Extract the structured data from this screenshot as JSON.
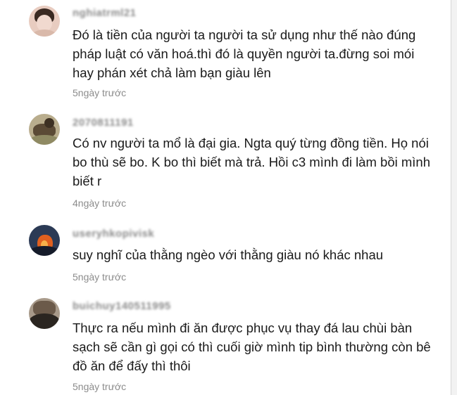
{
  "comments": [
    {
      "username": "nghiatrml21",
      "text": "Đó là tiền của người ta người ta sử dụng như thế nào đúng pháp luật có văn hoá.thì đó là quyền người ta.đừng soi mói hay phán xét chả làm bạn giàu lên",
      "time": "5ngày trước",
      "avatar_colors": [
        "#f1d9cf",
        "#3a2a22",
        "#d9b9aa"
      ]
    },
    {
      "username": "2070811191",
      "text": "Có nv người ta mổ là đại gia. Ngta quý từng đồng tiền. Họ nói bo thù sẽ bo. K bo thì biết mà trả. Hồi c3 mình đi làm bồi mình biết r",
      "time": "4ngày trước",
      "avatar_colors": [
        "#b9ad8d",
        "#5b4a35",
        "#8f8a63"
      ]
    },
    {
      "username": "useryhkopivisk",
      "text": "suy nghĩ của thằng ngèo với thằng giàu nó khác nhau",
      "time": "5ngày trước",
      "avatar_colors": [
        "#2b3a55",
        "#e0601f",
        "#151b2a"
      ]
    },
    {
      "username": "buichuy140511995",
      "text": "Thực ra nếu mình đi ăn được phục vụ thay đá lau chùi bàn sạch sẽ cần gì gọi có thì cuối giờ mình tip bình thường còn bê đồ ăn để đấy thì thôi",
      "time": "5ngày trước",
      "avatar_colors": [
        "#6b5a4a",
        "#2a2520",
        "#a89a8a"
      ]
    }
  ]
}
